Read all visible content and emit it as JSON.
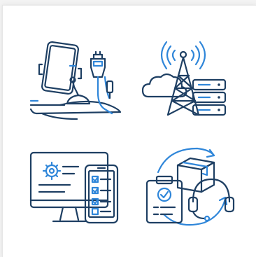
{
  "colors": {
    "outline": "#1e3f63",
    "accent": "#2f86d9",
    "tint": "#cfe2f6",
    "background": "#ffffff"
  },
  "icons": [
    "car-phone-holder-charger-icon",
    "cell-tower-cloud-server-icon",
    "monitor-phone-checklist-icon",
    "delivery-support-cycle-icon"
  ]
}
